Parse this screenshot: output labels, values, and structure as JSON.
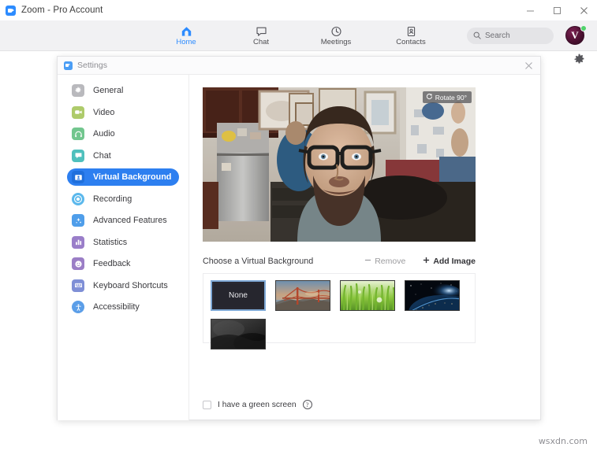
{
  "window": {
    "title": "Zoom - Pro Account",
    "logo_icon": "zoom-camera-icon",
    "controls": {
      "minimize": "minimize-icon",
      "maximize": "maximize-icon",
      "close": "close-icon"
    }
  },
  "navbar": {
    "items": [
      {
        "label": "Home",
        "icon": "home-icon",
        "active": true
      },
      {
        "label": "Chat",
        "icon": "chat-bubble-icon",
        "active": false
      },
      {
        "label": "Meetings",
        "icon": "clock-icon",
        "active": false
      },
      {
        "label": "Contacts",
        "icon": "contact-card-icon",
        "active": false
      }
    ],
    "search": {
      "placeholder": "Search",
      "icon": "search-icon"
    },
    "avatar": {
      "initial": "V",
      "status": "online",
      "status_color": "#4fd26b"
    },
    "gear": {
      "icon": "gear-icon"
    }
  },
  "settings": {
    "title": "Settings",
    "logo_icon": "zoom-camera-icon",
    "close_icon": "close-icon",
    "sidebar": {
      "items": [
        {
          "label": "General",
          "icon": "gear-icon",
          "color": "#b9b9bd",
          "active": false
        },
        {
          "label": "Video",
          "icon": "video-camera-icon",
          "color": "#aecb6b",
          "active": false
        },
        {
          "label": "Audio",
          "icon": "headphones-icon",
          "color": "#72c68e",
          "active": false
        },
        {
          "label": "Chat",
          "icon": "chat-bubble-icon",
          "color": "#4fc0bd",
          "active": false
        },
        {
          "label": "Virtual Background",
          "icon": "person-card-icon",
          "color": "#2d7ff0",
          "active": true
        },
        {
          "label": "Recording",
          "icon": "record-circle-icon",
          "color": "#5bb8ec",
          "active": false
        },
        {
          "label": "Advanced Features",
          "icon": "sparkle-icon",
          "color": "#4f9eea",
          "active": false
        },
        {
          "label": "Statistics",
          "icon": "bar-chart-icon",
          "color": "#9a7ec9",
          "active": false
        },
        {
          "label": "Feedback",
          "icon": "smiley-icon",
          "color": "#9b7ec6",
          "active": false
        },
        {
          "label": "Keyboard Shortcuts",
          "icon": "keyboard-icon",
          "color": "#7f8fd6",
          "active": false
        },
        {
          "label": "Accessibility",
          "icon": "accessibility-person-icon",
          "color": "#5b9ee8",
          "active": false
        }
      ]
    },
    "preview": {
      "rotate_label": "Rotate 90°",
      "rotate_icon": "rotate-icon"
    },
    "virtual_background": {
      "title": "Choose a Virtual Background",
      "remove_label": "Remove",
      "remove_icon": "minus-icon",
      "add_label": "Add Image",
      "add_icon": "plus-icon",
      "thumbnails": [
        {
          "name": "None",
          "label": "None",
          "selected": true
        },
        {
          "name": "Golden Gate Bridge",
          "label": "",
          "selected": false
        },
        {
          "name": "Grass",
          "label": "",
          "selected": false
        },
        {
          "name": "Earth from space",
          "label": "",
          "selected": false
        },
        {
          "name": "Dark abstract",
          "label": "",
          "selected": false
        }
      ]
    },
    "green_screen": {
      "label": "I have a green screen",
      "checked": false,
      "help_icon": "question-mark-icon",
      "help_glyph": "?"
    }
  },
  "watermark": {
    "text": "wsxdn.com"
  },
  "colors": {
    "accent_blue": "#2d8cff",
    "selected_blue": "#2d7ff0",
    "navbar_bg": "#f1f1f3",
    "status_green": "#4fd26b"
  }
}
